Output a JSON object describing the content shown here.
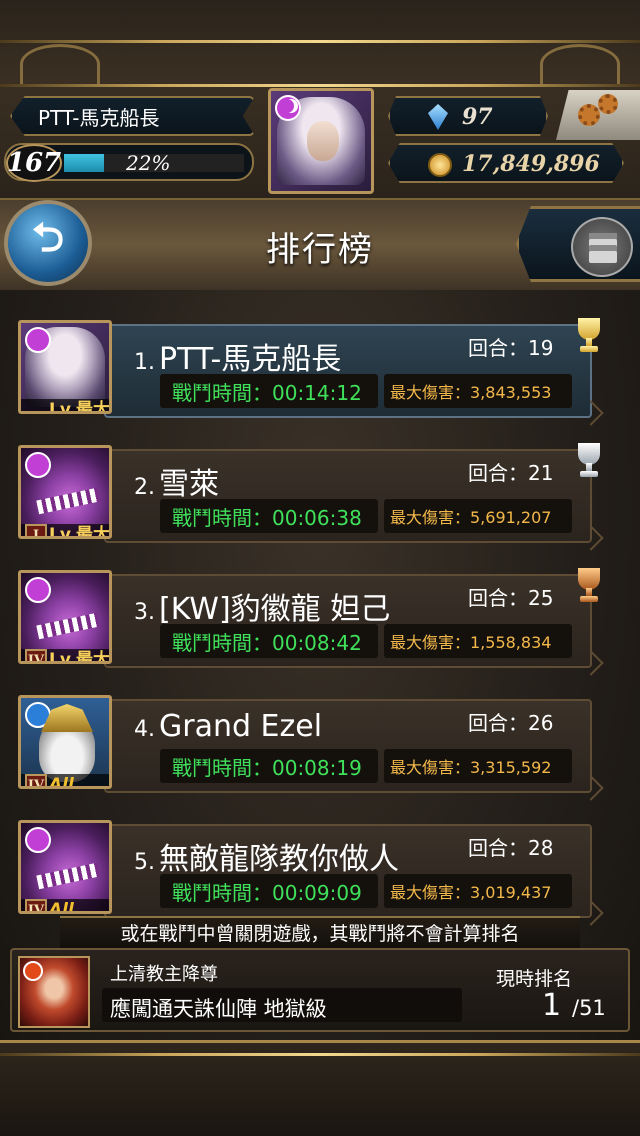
{
  "player": {
    "name": "PTT-馬克船長",
    "level": "167",
    "exp_percent_label": "22%",
    "exp_fraction": 0.22,
    "gems": "97",
    "coins": "17,849,896"
  },
  "header": {
    "title": "排行榜"
  },
  "rankings": [
    {
      "rank": "1.",
      "name": "PTT-馬克船長",
      "round": "回合：19",
      "battle_time": "戰鬥時間：00:14:12",
      "max_damage": "最大傷害：3,843,553",
      "level_badge": "Lv.最大",
      "tier": "",
      "trophy": "gold-trophy-icon",
      "portrait": "lady"
    },
    {
      "rank": "2.",
      "name": "雪萊",
      "round": "回合：21",
      "battle_time": "戰鬥時間：00:06:38",
      "max_damage": "最大傷害：5,691,207",
      "level_badge": "Lv.最大",
      "tier": "I",
      "trophy": "silver-trophy-icon",
      "portrait": "dragon"
    },
    {
      "rank": "3.",
      "name": "[KW]豹徽龍 妲己",
      "round": "回合：25",
      "battle_time": "戰鬥時間：00:08:42",
      "max_damage": "最大傷害：1,558,834",
      "level_badge": "Lv.最大",
      "tier": "IV",
      "trophy": "bronze-trophy-icon",
      "portrait": "dragon"
    },
    {
      "rank": "4.",
      "name": "Grand Ezel",
      "round": "回合：26",
      "battle_time": "戰鬥時間：00:08:19",
      "max_damage": "最大傷害：3,315,592",
      "level_badge": "All Max",
      "tier": "IV",
      "trophy": "",
      "portrait": "elder"
    },
    {
      "rank": "5.",
      "name": "無敵龍隊教你做人",
      "round": "回合：28",
      "battle_time": "戰鬥時間：00:09:09",
      "max_damage": "最大傷害：3,019,437",
      "level_badge": "All Max",
      "tier": "IV",
      "trophy": "",
      "portrait": "dragon"
    }
  ],
  "footer": {
    "notice": "或在戰鬥中曾關閉遊戲，其戰鬥將不會計算排名",
    "stage_subtitle": "上清教主降尊",
    "stage_name": "應闖通天誅仙陣 地獄級",
    "current_rank_label": "現時排名",
    "current_rank": "1",
    "total": "/51"
  },
  "icons": {
    "back": "back-arrow-icon",
    "menu": "list-menu-icon",
    "settings": "gear-icon",
    "gem": "gem-icon",
    "coin": "coin-icon"
  }
}
